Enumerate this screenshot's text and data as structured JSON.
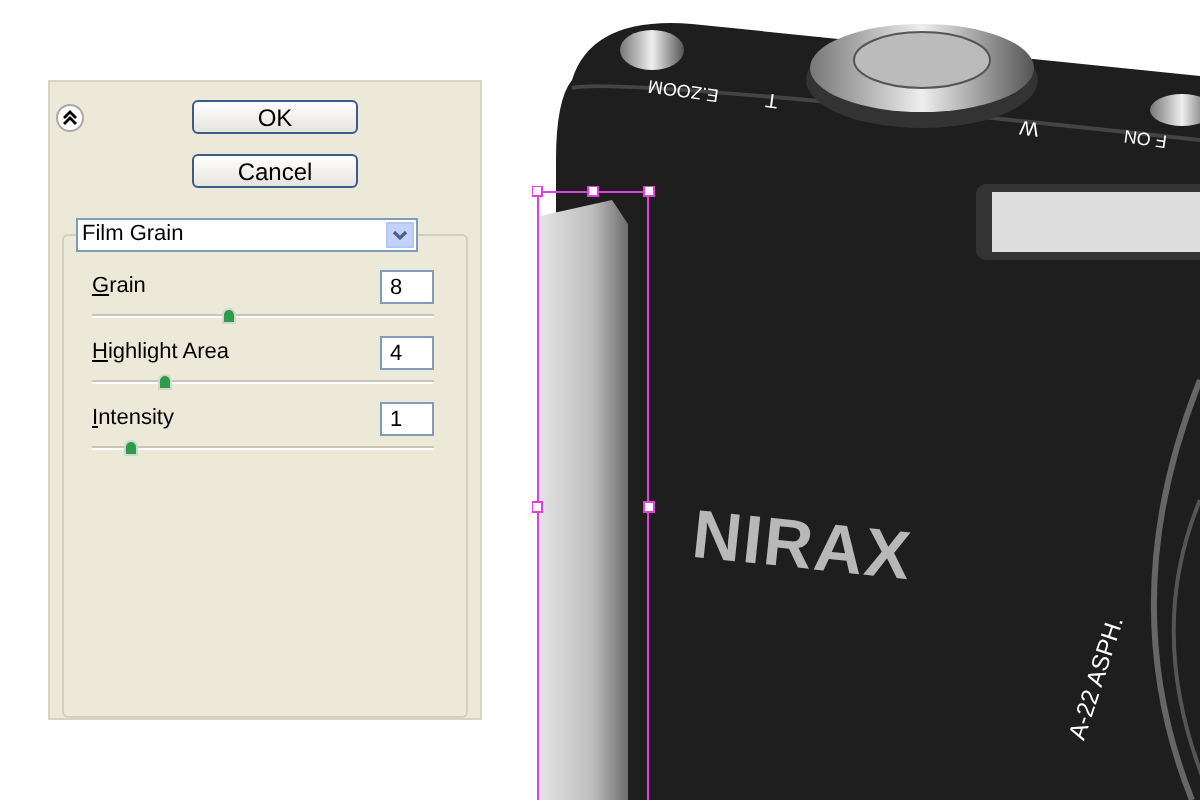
{
  "dialog": {
    "buttons": [
      "OK",
      "Cancel"
    ],
    "filter": {
      "value": "Film Grain"
    },
    "controls": [
      {
        "label": "Grain",
        "value": "8",
        "level": 0.4
      },
      {
        "label": "Highlight Area",
        "value": "4",
        "level": 0.21
      },
      {
        "label": "Intensity",
        "value": "1",
        "level": 0.11
      }
    ]
  },
  "artwork": {
    "logo": "NIRAX",
    "top_labels": [
      "E.ZOOM",
      "T",
      "W",
      "F ON"
    ],
    "lens_text": "A-22 ASPH.",
    "selection": true
  }
}
